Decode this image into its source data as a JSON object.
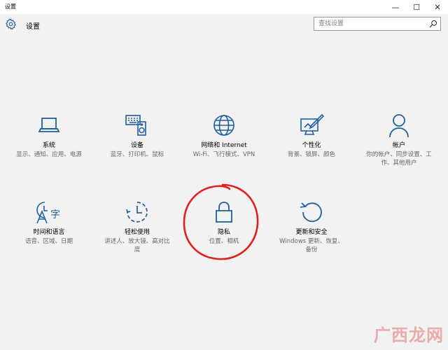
{
  "window": {
    "title": "设置",
    "minimize_glyph": "—",
    "maximize_glyph": "☐",
    "close_glyph": "✕"
  },
  "header": {
    "app_title": "设置",
    "search_placeholder": "查找设置"
  },
  "colors": {
    "icon_blue": "#1f5f9e",
    "annotation_red": "#e02020",
    "background": "#f2f2f2"
  },
  "tiles": [
    {
      "name": "系统",
      "desc": "显示、通知、应用、电源",
      "icon": "laptop-icon"
    },
    {
      "name": "设备",
      "desc": "蓝牙、打印机、鼠标",
      "icon": "devices-icon"
    },
    {
      "name": "网络和 Internet",
      "desc": "Wi-Fi、飞行模式、VPN",
      "icon": "globe-icon"
    },
    {
      "name": "个性化",
      "desc": "背景、锁屏、颜色",
      "icon": "personalization-icon"
    },
    {
      "name": "帐户",
      "desc": "你的帐户、同步设置、工作、其他用户",
      "icon": "person-icon"
    },
    {
      "name": "时间和语言",
      "desc": "语音、区域、日期",
      "icon": "time-language-icon"
    },
    {
      "name": "轻松使用",
      "desc": "讲述人、放大镜、高对比度",
      "icon": "ease-of-access-icon"
    },
    {
      "name": "隐私",
      "desc": "位置、相机",
      "icon": "lock-icon"
    },
    {
      "name": "更新和安全",
      "desc": "Windows 更新、恢复、备份",
      "icon": "update-icon"
    }
  ],
  "watermark": "广西龙网"
}
